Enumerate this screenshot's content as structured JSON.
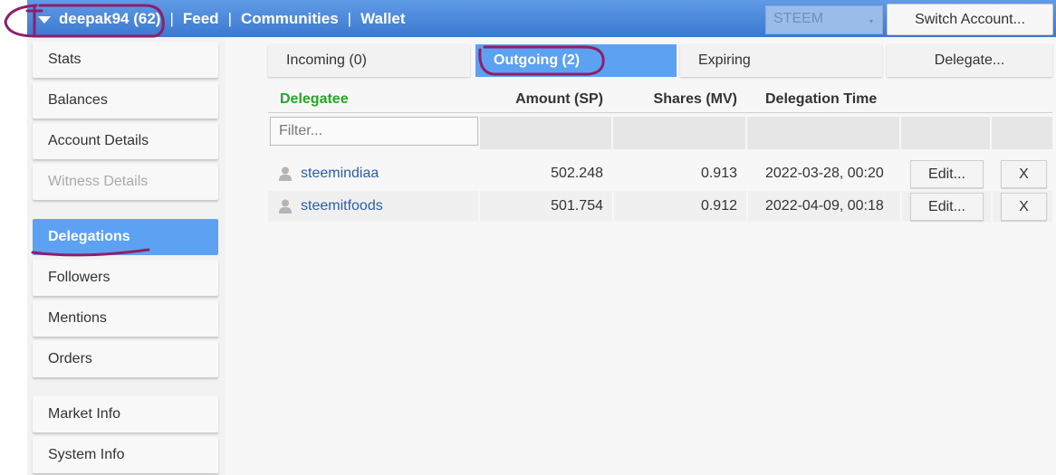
{
  "topbar": {
    "account": "deepak94 (62)",
    "nav": [
      "Feed",
      "Communities",
      "Wallet"
    ],
    "separator": "|",
    "chain_select": "STEEM",
    "select_arrow": "▾",
    "switch_account": "Switch Account..."
  },
  "sidebar": {
    "items": [
      {
        "label": "Stats"
      },
      {
        "label": "Balances"
      },
      {
        "label": "Account Details"
      },
      {
        "label": "Witness Details"
      },
      {
        "label": "Delegations"
      },
      {
        "label": "Followers"
      },
      {
        "label": "Mentions"
      },
      {
        "label": "Orders"
      },
      {
        "label": "Market Info"
      },
      {
        "label": "System Info"
      }
    ]
  },
  "tabs": [
    {
      "label": "Incoming (0)"
    },
    {
      "label": "Outgoing (2)"
    },
    {
      "label": "Expiring"
    },
    {
      "label": "Delegate..."
    }
  ],
  "table": {
    "headers": [
      "Delegatee",
      "Amount (SP)",
      "Shares (MV)",
      "Delegation Time"
    ],
    "filter_placeholder": "Filter...",
    "rows": [
      {
        "delegatee": "steemindiaa",
        "amount": "502.248",
        "shares": "0.913",
        "time": "2022-03-28, 00:20",
        "edit": "Edit...",
        "remove": "X"
      },
      {
        "delegatee": "steemitfoods",
        "amount": "501.754",
        "shares": "0.912",
        "time": "2022-04-09, 00:18",
        "edit": "Edit...",
        "remove": "X"
      }
    ]
  },
  "colors": {
    "topbar": "#4a86d8",
    "active": "#5da1f2",
    "delegatee_header": "#28a528",
    "link": "#2a5ea8",
    "annotation": "#8e1f6b"
  }
}
